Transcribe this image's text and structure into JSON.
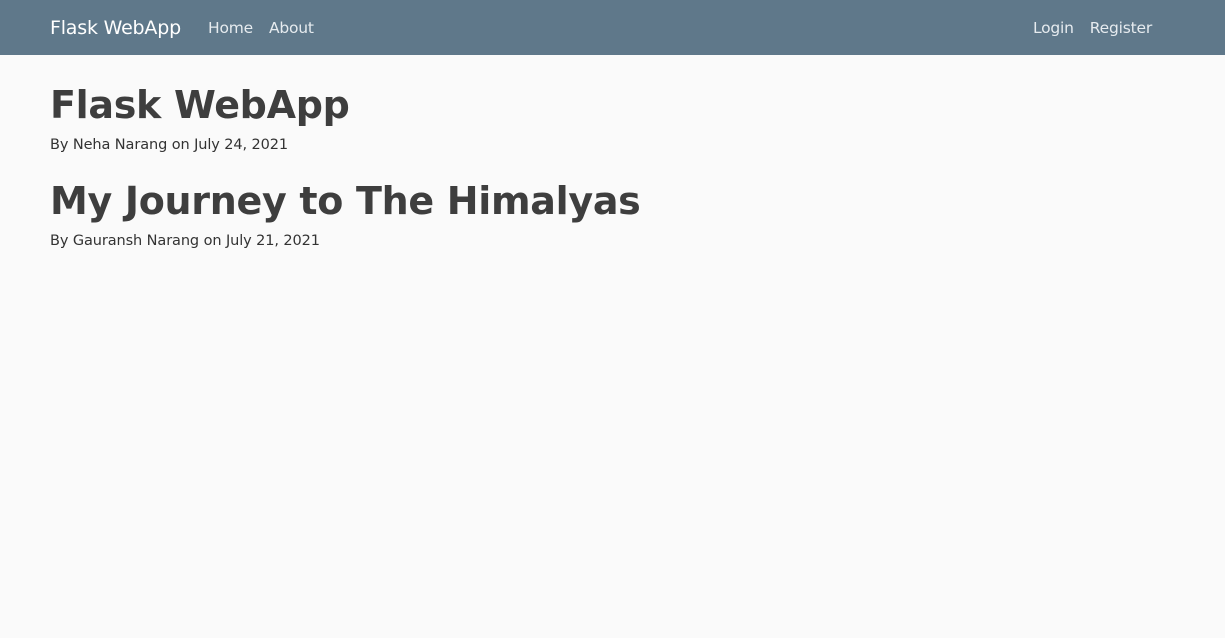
{
  "navbar": {
    "brand": "Flask WebApp",
    "left_links": [
      "Home",
      "About"
    ],
    "right_links": [
      "Login",
      "Register"
    ],
    "background": "#5f788a"
  },
  "posts": [
    {
      "title": "Flask WebApp",
      "author": "Neha Narang",
      "date": "July 24, 2021"
    },
    {
      "title": "My Journey to The Himalyas",
      "author": "Gauransh Narang",
      "date": "July 21, 2021"
    }
  ],
  "labels": {
    "by": "By",
    "on": "on"
  }
}
